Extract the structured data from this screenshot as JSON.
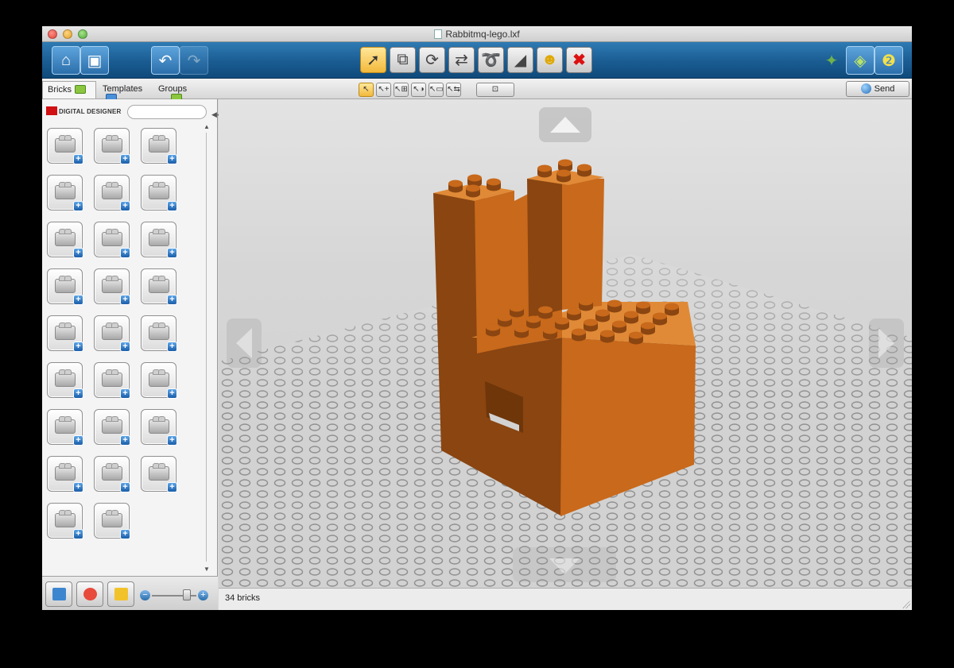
{
  "window": {
    "title": "Rabbitmq-lego.lxf"
  },
  "toolbar": {
    "left": [
      {
        "name": "home",
        "icon": "home-icon",
        "glyph": "⌂"
      },
      {
        "name": "save",
        "icon": "save-icon",
        "glyph": "▣"
      },
      {
        "name": "undo",
        "icon": "undo-icon",
        "glyph": "↶"
      },
      {
        "name": "redo",
        "icon": "redo-icon",
        "glyph": "↷"
      }
    ],
    "tools": [
      {
        "name": "select-tool",
        "icon": "cursor-icon",
        "glyph": "➚",
        "active": true
      },
      {
        "name": "clone-tool",
        "icon": "clone-icon",
        "glyph": "⧉"
      },
      {
        "name": "hinge-tool",
        "icon": "hinge-icon",
        "glyph": "⟳"
      },
      {
        "name": "hinge-align-tool",
        "icon": "hinge-align-icon",
        "glyph": "⇄"
      },
      {
        "name": "flex-tool",
        "icon": "flex-icon",
        "glyph": "➰"
      },
      {
        "name": "paint-tool",
        "icon": "paint-bucket-icon",
        "glyph": "◢"
      },
      {
        "name": "decoration-tool",
        "icon": "minifig-head-icon",
        "glyph": "☻"
      },
      {
        "name": "delete-tool",
        "icon": "delete-x-icon",
        "glyph": "✖"
      }
    ],
    "modes": [
      {
        "name": "build-mode",
        "icon": "build-mode-icon",
        "glyph": "✦"
      },
      {
        "name": "view-mode",
        "icon": "view-mode-icon",
        "glyph": "◈"
      },
      {
        "name": "instructions-mode",
        "icon": "instructions-icon",
        "glyph": "❷"
      }
    ]
  },
  "tabs": [
    {
      "label": "Bricks",
      "active": true
    },
    {
      "label": "Templates"
    },
    {
      "label": "Groups"
    }
  ],
  "selection_tools": [
    {
      "name": "single-select",
      "glyph": "↖",
      "active": true
    },
    {
      "name": "multi-select",
      "glyph": "↖+"
    },
    {
      "name": "connected-select",
      "glyph": "↖⊞"
    },
    {
      "name": "color-select",
      "glyph": "↖◑"
    },
    {
      "name": "shape-select",
      "glyph": "↖▭"
    },
    {
      "name": "invert-select",
      "glyph": "↖⇆"
    }
  ],
  "hide_button": {
    "glyph": "⊡"
  },
  "send_button": {
    "label": "Send"
  },
  "panel": {
    "logo_text": "DIGITAL DESIGNER",
    "search": {
      "value": "",
      "placeholder": ""
    },
    "bricks": [
      "brick-2x2",
      "brick-round-1x1",
      "brick-with-knob",
      "brick-technic-1x4",
      "slope-brick",
      "wedge-brick",
      "arch-brick",
      "plate-2x2",
      "wedge-plate",
      "plate-with-clip",
      "panel-corner",
      "bracket-plate",
      "door-piece",
      "gear-wheel",
      "antenna-piece",
      "minifigure",
      "tire-piece",
      "cylinder-barrel",
      "technic-beam",
      "technic-liftarm",
      "technic-axle",
      "cog-gear",
      "transparent-tube",
      "tile-decorated",
      "robot-arm-piece",
      "ramp-piece"
    ],
    "bottom_buttons": [
      {
        "name": "add-brick-button",
        "color": "#3d86cf"
      },
      {
        "name": "color-palette-button",
        "color": "#e84a3c"
      },
      {
        "name": "build-book-button",
        "color": "#f2c22b"
      }
    ],
    "zoom": {
      "level": 0.85
    }
  },
  "model": {
    "color": "#c8691b",
    "color_dark": "#8a4511",
    "color_light": "#e08a37"
  },
  "status": {
    "brick_count_text": "34 bricks"
  }
}
